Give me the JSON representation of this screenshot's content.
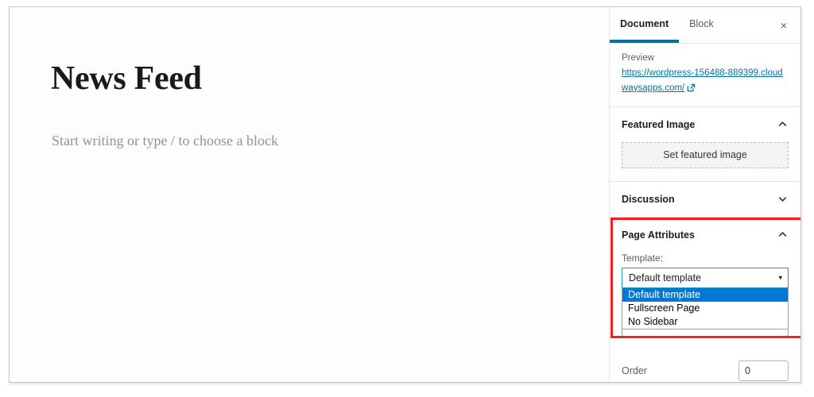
{
  "editor": {
    "title": "News Feed",
    "placeholder": "Start writing or type / to choose a block"
  },
  "sidebar": {
    "tabs": [
      {
        "label": "Document",
        "active": true
      },
      {
        "label": "Block",
        "active": false
      }
    ],
    "close_label": "×",
    "preview": {
      "label": "Preview",
      "url": "https://wordpress-156488-889399.cloudwaysapps.com/",
      "external_icon": "external-link-icon"
    },
    "featured_image": {
      "title": "Featured Image",
      "button_label": "Set featured image",
      "toggle_icon": "chevron-up-icon"
    },
    "discussion": {
      "title": "Discussion",
      "toggle_icon": "chevron-down-icon"
    },
    "page_attributes": {
      "title": "Page Attributes",
      "toggle_icon": "chevron-up-icon",
      "template_label": "Template:",
      "template_value": "Default template",
      "dropdown_arrow": "▾",
      "options": [
        {
          "label": "Default template",
          "selected": true
        },
        {
          "label": "Fullscreen Page",
          "selected": false
        },
        {
          "label": "No Sidebar",
          "selected": false
        }
      ],
      "order_label": "Order",
      "order_value": "0"
    }
  },
  "colors": {
    "accent": "#00739c",
    "link": "#0073aa",
    "highlight": "#0078d7",
    "annotation": "#ee2222",
    "focus_border": "#1f9ac9"
  }
}
